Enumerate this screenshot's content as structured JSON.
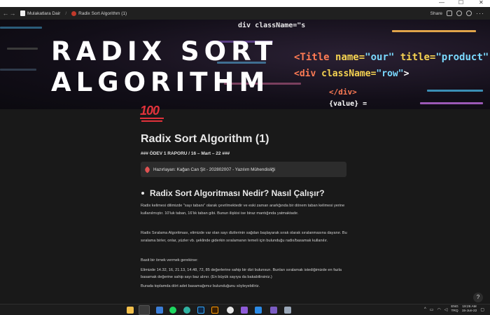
{
  "breadcrumb": {
    "parent": "Mulakatlara Dair",
    "separator": "/",
    "current": "Radix Sort Algorithm (1)"
  },
  "topbar": {
    "share_label": "Share"
  },
  "cover": {
    "title_line1": "RADIX SORT",
    "title_line2": "ALGORITHM",
    "code_line1": "div className=\"s",
    "code_line2_tag": "<Title ",
    "code_line2_attr1": "name=",
    "code_line2_str1": "\"our\" ",
    "code_line2_attr2": "title=",
    "code_line2_str2": "\"product\"",
    "code_line3_tag": "<div ",
    "code_line3_attr": "className=",
    "code_line3_str": "\"row\"",
    "code_line3_end": ">",
    "code_line4": "</div>",
    "code_line5": "{value} ="
  },
  "page": {
    "emoji": "100",
    "title": "Radix Sort Algorithm (1)",
    "subtitle": "### ÖDEV 1 RAPORU / 16 – Mart – 22 ###",
    "callout": "Hazırlayan: Kağan Can Şit  -  202802007 - Yazılım Mühendisliği",
    "heading": "Radix Sort Algoritması Nedir? Nasıl Çalışır?",
    "p1": "Radix kelimesi dilimizde \"sayı tabanı\" olarak çevrilmektedir ve eski zaman ararkğında bir dönem taban kelimesi yerine kullanılmıştır. 10'luk taban, 16'lık taban gibi. Bunun ilişkisi ise biraz mantığında yatmaktadır.",
    "p2": "Radix Sıralama Algoritması, elimizde var olan sayı dizilerinin sağdan başlayarak sırak olarak sıralanmasına dayanır. Bu sıralama birler, onlar, yüzler vb. şeklinde giderkin sıralamanın temeli için bulunduğu radix/basamak kullanılır.",
    "p3": "Basit bir örnek vermek gerekirse:",
    "p4": "Elimizde 14.32, 16, 21.13, 14.48, 72, 85 değerlerine sahip bir dizi bulunsun. Bunları sıralamak istediğimizde en fazla basamak değerine sahip sayı baz alınır. (En büyük sayıya da bakabilirsiniz.)",
    "p5": "Burada toplamda dört adet basamağımız bulunduğunu söyleyebiliriz."
  },
  "help_label": "?",
  "tray": {
    "lang_top": "ENG",
    "lang_bottom": "TRQ",
    "time": "19:26 AM",
    "date": "15-Jun-22"
  },
  "colors": {
    "bg": "#191919",
    "accent_red": "#e2323b"
  }
}
